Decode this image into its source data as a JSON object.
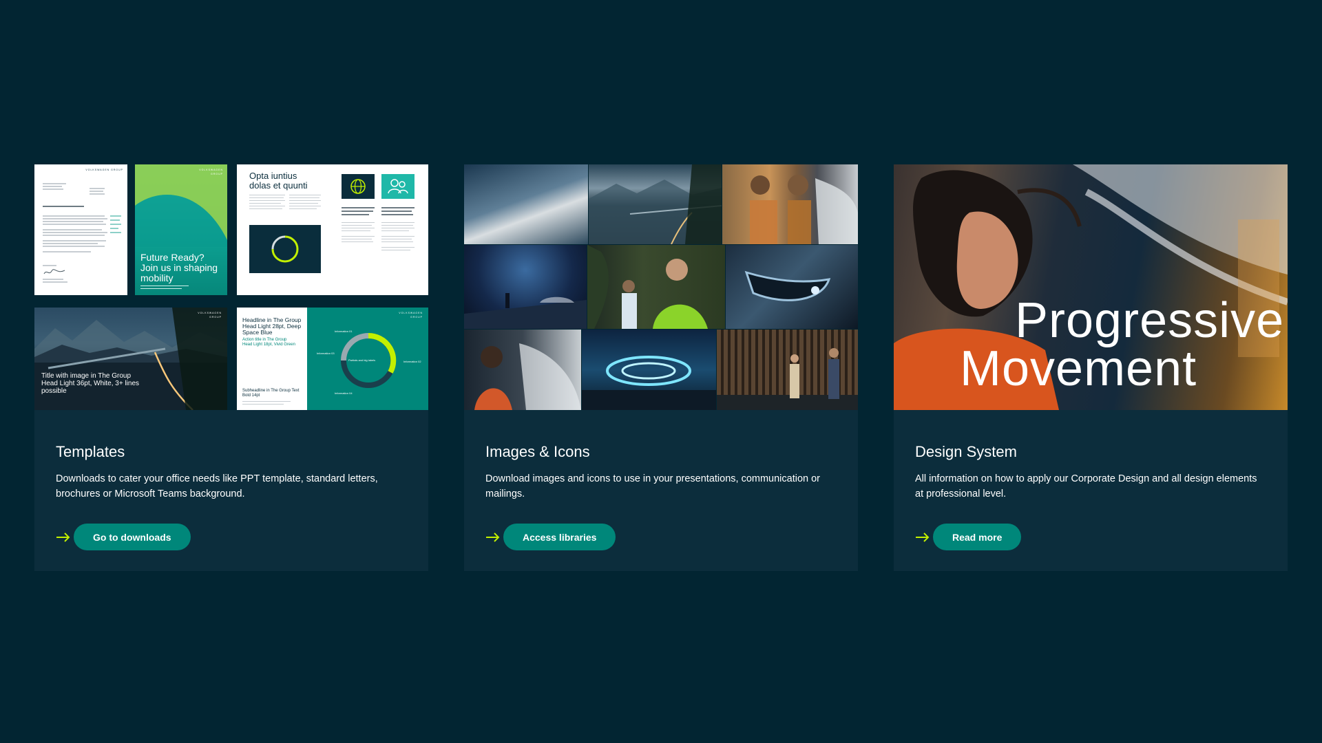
{
  "cards": [
    {
      "title": "Templates",
      "description": "Downloads to cater your office needs like PPT template, standard letters, brochures or Microsoft Teams background.",
      "button_label": "Go to downloads",
      "preview": {
        "brand": "VOLKSWAGEN GROUP",
        "brand_line1": "VOLKSWAGEN",
        "brand_line2": "GROUP",
        "brochure_headline": "Future Ready? Join us in shaping mobility",
        "report_headline": "Opta iuntius dolas et quunti",
        "slide_headline": "Title with image in The Group Head Light 36pt, White, 3+ lines possible",
        "doc_headline": "Headline in The Group Head Light 28pt, Deep Space Blue",
        "doc_subline": "Action title in The Group Head Light 18pt, Vivid Green",
        "doc_subheadline": "Subheadline in The Group Text Bold 14pt",
        "chart_center": "Partials and big labels",
        "chart_labels": [
          "Information 01",
          "Information 02",
          "Information 03",
          "Information 04"
        ]
      }
    },
    {
      "title": "Images & Icons",
      "description": "Download images and icons to use in your presentations, communication or mailings.",
      "button_label": "Access libraries"
    },
    {
      "title": "Design System",
      "description": "All information on how to apply our Corporate Design and all design elements at professional level.",
      "button_label": "Read more",
      "hero_line1": "Progressive",
      "hero_line2": "Movement"
    }
  ],
  "icons": {
    "cta_arrow": "arrow-right-icon",
    "globe": "globe-icon",
    "people": "people-icon"
  },
  "colors": {
    "background": "#022532",
    "card": "#0c2d3c",
    "button": "#00877a",
    "accent_arrow": "#c2f000"
  }
}
